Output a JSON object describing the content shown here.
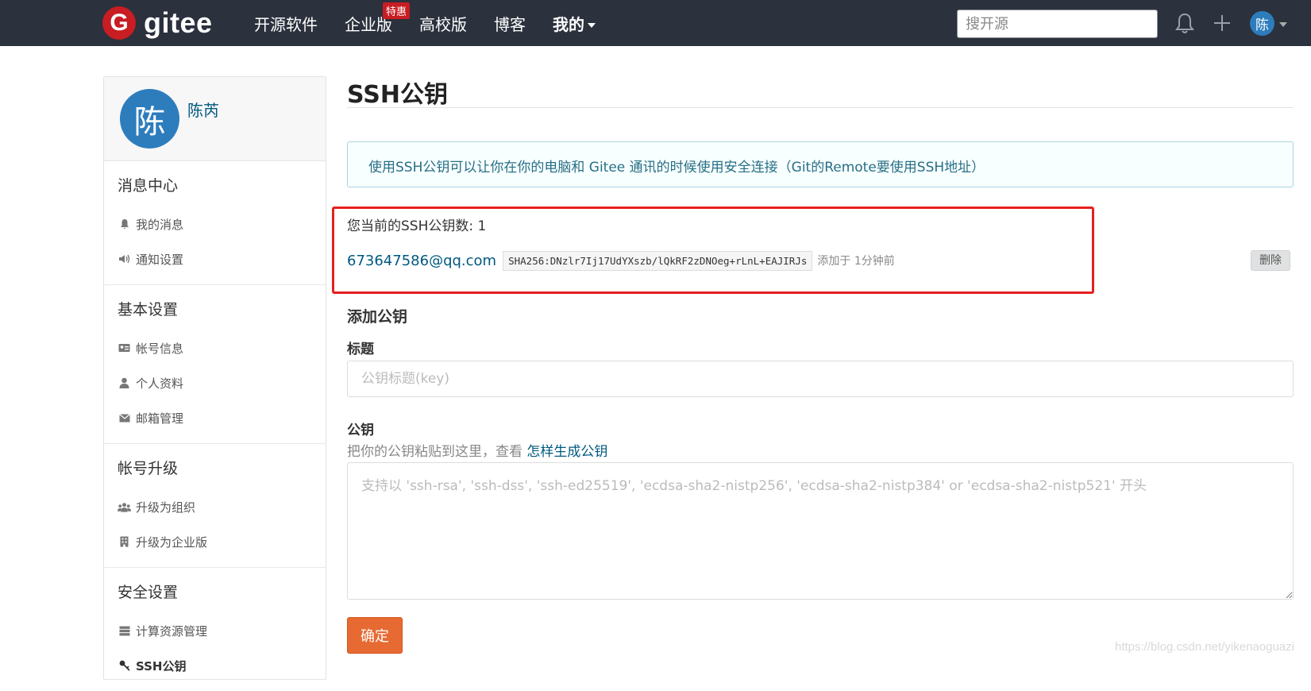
{
  "nav": {
    "logo_letter": "G",
    "logo_text": "gitee",
    "items": [
      {
        "label": "开源软件"
      },
      {
        "label": "企业版",
        "badge": "特惠"
      },
      {
        "label": "高校版"
      },
      {
        "label": "博客"
      },
      {
        "label": "我的"
      }
    ],
    "search_placeholder": "搜开源",
    "avatar_char": "陈"
  },
  "sidebar": {
    "avatar_char": "陈",
    "user_name": "陈芮",
    "sections": [
      {
        "title": "消息中心",
        "items": [
          {
            "label": "我的消息",
            "icon": "bell-icon"
          },
          {
            "label": "通知设置",
            "icon": "volume-icon"
          }
        ]
      },
      {
        "title": "基本设置",
        "items": [
          {
            "label": "帐号信息",
            "icon": "id-card-icon"
          },
          {
            "label": "个人资料",
            "icon": "user-icon"
          },
          {
            "label": "邮箱管理",
            "icon": "envelope-icon"
          }
        ]
      },
      {
        "title": "帐号升级",
        "items": [
          {
            "label": "升级为组织",
            "icon": "users-icon"
          },
          {
            "label": "升级为企业版",
            "icon": "building-icon"
          }
        ]
      },
      {
        "title": "安全设置",
        "items": [
          {
            "label": "计算资源管理",
            "icon": "server-icon"
          },
          {
            "label": "SSH公钥",
            "icon": "key-icon"
          }
        ]
      }
    ]
  },
  "main": {
    "title": "SSH公钥",
    "info": "使用SSH公钥可以让你在你的电脑和 Gitee 通讯的时候使用安全连接（Git的Remote要使用SSH地址）",
    "key_count_label": "您当前的SSH公钥数: 1",
    "key": {
      "title": "673647586@qq.com",
      "fingerprint": "SHA256:DNzlr7Ij17UdYXszb/lQkRF2zDNOeg+rLnL+EAJIRJs",
      "added": "添加于 1分钟前",
      "delete_label": "删除"
    },
    "add_heading": "添加公钥",
    "title_label": "标题",
    "title_placeholder": "公钥标题(key)",
    "key_label": "公钥",
    "key_hint": "把你的公钥粘贴到这里，查看",
    "key_hint_link": "怎样生成公钥",
    "key_placeholder": "支持以 'ssh-rsa', 'ssh-dss', 'ssh-ed25519', 'ecdsa-sha2-nistp256', 'ecdsa-sha2-nistp384' or 'ecdsa-sha2-nistp521' 开头",
    "submit_label": "确定"
  },
  "watermark": "https://blog.csdn.net/yikenaoguazi",
  "colors": {
    "nav_bg": "#2b313d",
    "brand": "#c71d23",
    "accent": "#e66a32",
    "link": "#005980",
    "highlight": "#e5201f"
  }
}
